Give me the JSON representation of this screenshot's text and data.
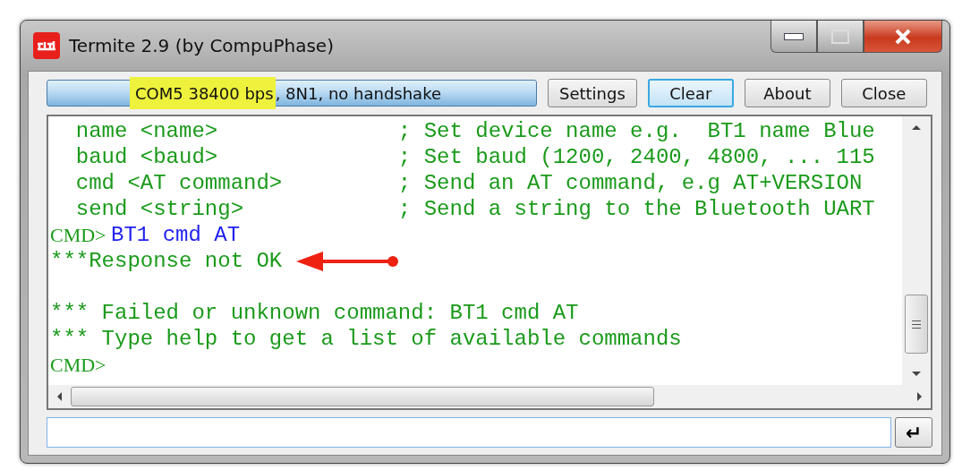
{
  "window": {
    "title": "Termite 2.9 (by CompuPhase)"
  },
  "status": {
    "highlighted": "COM5 38400 bps",
    "rest": ", 8N1, no handshake"
  },
  "buttons": [
    {
      "label": "Settings",
      "selected": false
    },
    {
      "label": "Clear",
      "selected": true
    },
    {
      "label": "About",
      "selected": false
    },
    {
      "label": "Close",
      "selected": false
    }
  ],
  "terminal": {
    "lines": [
      {
        "kind": "text",
        "segments": [
          {
            "kind": "output",
            "text": "  name <name>              ; Set device name e.g.  BT1 name Blue"
          }
        ]
      },
      {
        "kind": "text",
        "segments": [
          {
            "kind": "output",
            "text": "  baud <baud>              ; Set baud (1200, 2400, 4800, ... 115"
          }
        ]
      },
      {
        "kind": "text",
        "segments": [
          {
            "kind": "output",
            "text": "  cmd <AT command>         ; Send an AT command, e.g AT+VERSION"
          }
        ]
      },
      {
        "kind": "text",
        "segments": [
          {
            "kind": "output",
            "text": "  send <string>            ; Send a string to the Bluetooth UART"
          }
        ]
      },
      {
        "kind": "text",
        "segments": [
          {
            "kind": "prompt",
            "text": "CMD> "
          },
          {
            "kind": "input",
            "text": "BT1 cmd AT"
          }
        ]
      },
      {
        "kind": "text",
        "segments": [
          {
            "kind": "output",
            "text": "***Response not OK",
            "arrow": true
          }
        ]
      },
      {
        "kind": "blank"
      },
      {
        "kind": "text",
        "segments": [
          {
            "kind": "output",
            "text": "*** Failed or unknown command: BT1 cmd AT"
          }
        ]
      },
      {
        "kind": "text",
        "segments": [
          {
            "kind": "output",
            "text": "*** Type help to get a list of available commands"
          }
        ]
      },
      {
        "kind": "text",
        "segments": [
          {
            "kind": "prompt",
            "text": "CMD>"
          }
        ]
      }
    ]
  },
  "send_button": {
    "label": "↵"
  }
}
